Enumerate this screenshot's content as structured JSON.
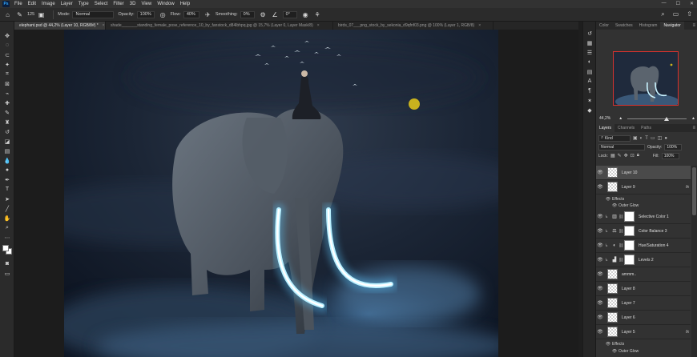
{
  "app": {
    "logo_text": "Ps"
  },
  "menu": {
    "items": [
      "File",
      "Edit",
      "Image",
      "Layer",
      "Type",
      "Select",
      "Filter",
      "3D",
      "View",
      "Window",
      "Help"
    ],
    "window_controls": [
      "—",
      "☐",
      "✕"
    ]
  },
  "options_bar": {
    "brush_size": "125",
    "mode_label": "Mode:",
    "mode_value": "Normal",
    "opacity_label": "Opacity:",
    "opacity_value": "100%",
    "flow_label": "Flow:",
    "flow_value": "40%",
    "smoothing_label": "Smoothing:",
    "smoothing_value": "0%",
    "angle_value": "0°"
  },
  "tabs": [
    {
      "label": "elephant.psd @ 44,2% (Layer 10, RGB/8#) *",
      "active": true
    },
    {
      "label": "shade_______standing_female_pose_reference_10_by_fanstock_d84lbhpq.jpg @ 15,7% (Layer 0, Layer Mask/8)",
      "active": false
    },
    {
      "label": "birds_07___png_stock_by_sekonia_d9qfnf03.png @ 100% (Layer 1, RGB/8)",
      "active": false
    }
  ],
  "panels": {
    "top_tabs": [
      "Color",
      "Swatches",
      "Histogram",
      "Navigator"
    ],
    "top_active": "Navigator",
    "navigator_zoom": "44,2%",
    "layer_tabs": [
      "Layers",
      "Channels",
      "Paths"
    ],
    "layer_active": "Layers",
    "filter_kind": "Kind",
    "blend_mode": "Normal",
    "opacity_label": "Opacity:",
    "opacity_value": "100%",
    "lock_label": "Lock:",
    "fill_label": "Fill:",
    "fill_value": "100%"
  },
  "layers": [
    {
      "name": "Layer 10",
      "type": "pixel",
      "selected": true,
      "fx": false
    },
    {
      "name": "Layer 9",
      "type": "pixel",
      "selected": false,
      "fx": true,
      "effects": [
        "Effects",
        "Outer Glow"
      ]
    },
    {
      "name": "Selective Color 1",
      "type": "adjustment",
      "icon": "▥",
      "selected": false,
      "fx": false
    },
    {
      "name": "Color Balance 3",
      "type": "adjustment",
      "icon": "⚖",
      "selected": false,
      "fx": false
    },
    {
      "name": "Hue/Saturation 4",
      "type": "adjustment",
      "icon": "◐",
      "selected": false,
      "fx": false
    },
    {
      "name": "Levels 2",
      "type": "adjustment",
      "icon": "▟",
      "selected": false,
      "fx": false
    },
    {
      "name": "ammm..",
      "type": "pixel",
      "selected": false,
      "fx": false
    },
    {
      "name": "Layer 8",
      "type": "pixel",
      "selected": false,
      "fx": false
    },
    {
      "name": "Layer 7",
      "type": "pixel",
      "selected": false,
      "fx": false
    },
    {
      "name": "Layer 6",
      "type": "pixel",
      "selected": false,
      "fx": false
    },
    {
      "name": "Layer 5",
      "type": "pixel",
      "selected": false,
      "fx": true,
      "effects": [
        "Effects",
        "Outer Glow"
      ]
    }
  ],
  "fx_label": "fx",
  "colors": {
    "glow": "#9fe8ff",
    "moon": "#c9b21e",
    "accent_red": "#d8322e"
  }
}
